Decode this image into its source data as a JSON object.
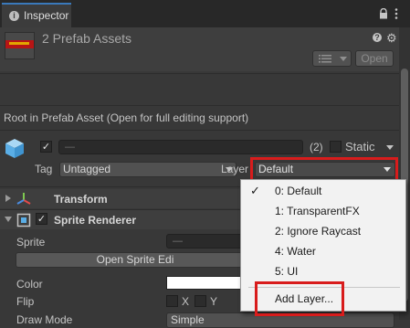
{
  "tab": {
    "label": "Inspector",
    "icon": "info-icon"
  },
  "header": {
    "title": "2 Prefab Assets",
    "open_label": "Open"
  },
  "root_message": "Root in Prefab Asset (Open for full editing support)",
  "gameobject": {
    "name_value": "—",
    "count": "(2)",
    "static_label": "Static",
    "tag_label": "Tag",
    "tag_value": "Untagged",
    "layer_label": "Layer",
    "layer_value": "Default"
  },
  "components": {
    "transform": "Transform",
    "sprite_renderer": "Sprite Renderer"
  },
  "sprite_renderer": {
    "sprite_label": "Sprite",
    "sprite_value": "—",
    "open_sprite_editor": "Open Sprite Edi",
    "color_label": "Color",
    "flip_label": "Flip",
    "flip_x": "X",
    "flip_y": "Y",
    "draw_mode_label": "Draw Mode",
    "draw_mode_value": "Simple"
  },
  "layer_menu": {
    "items": [
      {
        "label": "0: Default",
        "checked": true
      },
      {
        "label": "1: TransparentFX",
        "checked": false
      },
      {
        "label": "2: Ignore Raycast",
        "checked": false
      },
      {
        "label": "4: Water",
        "checked": false
      },
      {
        "label": "5: UI",
        "checked": false
      }
    ],
    "add_layer": "Add Layer..."
  },
  "colors": {
    "highlight": "#d81c1c",
    "tab_accent": "#3a79bb",
    "background": "#383838"
  }
}
